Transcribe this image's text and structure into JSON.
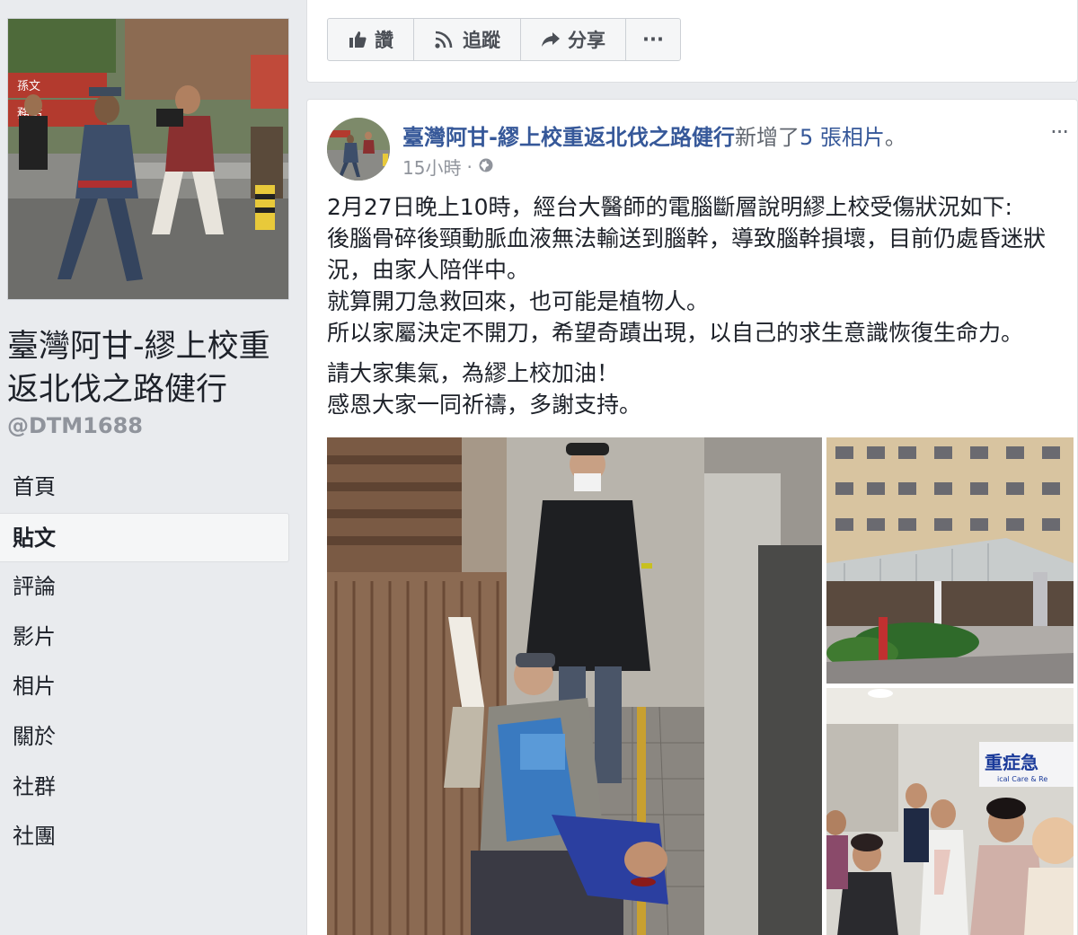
{
  "page": {
    "name": "臺灣阿甘-繆上校重返北伐之路健行",
    "handle": "@DTM1688"
  },
  "nav": {
    "items": [
      {
        "label": "首頁",
        "active": false
      },
      {
        "label": "貼文",
        "active": true
      },
      {
        "label": "評論",
        "active": false
      },
      {
        "label": "影片",
        "active": false
      },
      {
        "label": "相片",
        "active": false
      },
      {
        "label": "關於",
        "active": false
      },
      {
        "label": "社群",
        "active": false
      },
      {
        "label": "社團",
        "active": false
      }
    ]
  },
  "actions": {
    "like_label": "讚",
    "follow_label": "追蹤",
    "share_label": "分享",
    "more_label": "···"
  },
  "post": {
    "author": "臺灣阿甘-繆上校重返北伐之路健行",
    "action": "新增了",
    "count": "5 張相片",
    "period": "。",
    "time": "15小時",
    "dot": "·",
    "more": "···",
    "paragraphs": [
      "2月27日晚上10時，經台大醫師的電腦斷層說明繆上校受傷狀況如下:\n後腦骨碎後頸動脈血液無法輸送到腦幹，導致腦幹損壞，目前仍處昏迷狀況，由家人陪伴中。\n就算開刀急救回來，也可能是植物人。\n所以家屬決定不開刀，希望奇蹟出現，以自己的求生意識恢復生命力。",
      "請大家集氣，為繆上校加油！\n感恩大家一同祈禱，多謝支持。"
    ]
  },
  "photos": {
    "profile_banner_1": "孫文",
    "profile_banner_2": "務站",
    "hospital_sign": "重症急",
    "hospital_sign_en": "ical Care & Re"
  },
  "colors": {
    "link": "#365899",
    "background": "#e9ebee",
    "text": "#1d2129",
    "muted": "#90949c"
  }
}
